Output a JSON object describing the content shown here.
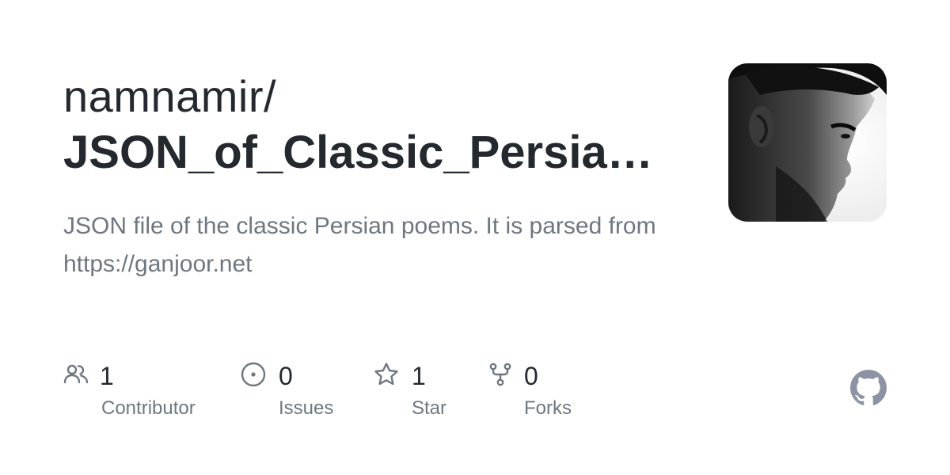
{
  "repo": {
    "owner": "namnamir/",
    "name": "JSON_of_Classic_Persian_Poems",
    "description": "JSON file of the classic Persian poems. It is parsed from https://ganjoor.net"
  },
  "stats": [
    {
      "icon": "people-icon",
      "count": "1",
      "label": "Contributor"
    },
    {
      "icon": "issue-opened-icon",
      "count": "0",
      "label": "Issues"
    },
    {
      "icon": "star-icon",
      "count": "1",
      "label": "Star"
    },
    {
      "icon": "repo-forked-icon",
      "count": "0",
      "label": "Forks"
    }
  ],
  "colors": {
    "title": "#24292f",
    "muted": "#6e7781",
    "github_mark": "#8b93a5"
  }
}
